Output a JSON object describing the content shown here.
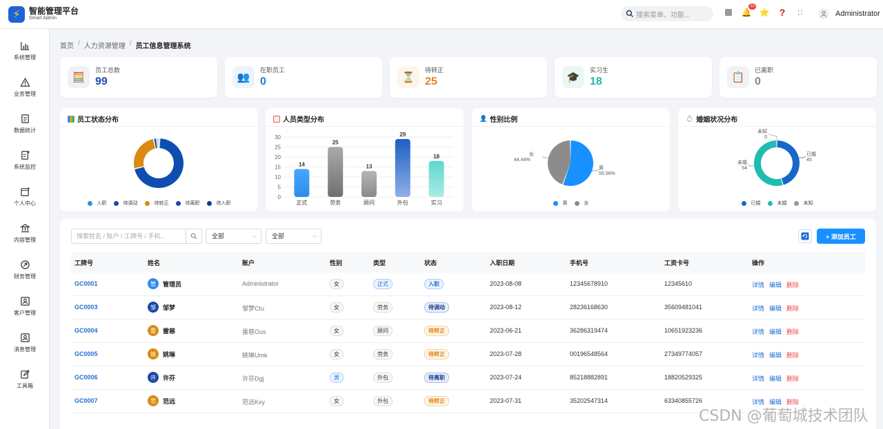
{
  "app": {
    "title": "智能管理平台",
    "subtitle": "Smart Admin"
  },
  "topbar": {
    "search_placeholder": "搜索菜单、功能...",
    "notification_count": "12",
    "username": "Administrator"
  },
  "sidebar": {
    "items": [
      {
        "label": "系统管理",
        "icon": "bar-chart-icon"
      },
      {
        "label": "业务管理",
        "icon": "warning-triangle-icon"
      },
      {
        "label": "数据统计",
        "icon": "document-icon"
      },
      {
        "label": "系统监控",
        "icon": "document-plus-icon"
      },
      {
        "label": "个人中心",
        "icon": "calendar-plus-icon"
      },
      {
        "label": "内容管理",
        "icon": "bank-icon"
      },
      {
        "label": "财务管理",
        "icon": "arrow-circle-icon"
      },
      {
        "label": "客户管理",
        "icon": "person-card-icon"
      },
      {
        "label": "消息管理",
        "icon": "person-card-icon"
      },
      {
        "label": "工具箱",
        "icon": "edit-box-icon"
      }
    ]
  },
  "breadcrumb": [
    "首页",
    "人力资源管理",
    "员工信息管理系统"
  ],
  "stats": [
    {
      "label": "员工总数",
      "value": "99",
      "color": "#1b4fa8",
      "bg": "#eef2f8",
      "icon": "🧮"
    },
    {
      "label": "在职员工",
      "value": "0",
      "color": "#1f7de0",
      "bg": "#edf3fa",
      "icon": "👥"
    },
    {
      "label": "待转正",
      "value": "25",
      "color": "#e0861a",
      "bg": "#fdf4ea",
      "icon": "⏳"
    },
    {
      "label": "实习生",
      "value": "18",
      "color": "#23b8a8",
      "bg": "#e9f7f5",
      "icon": "🎓"
    },
    {
      "label": "已离职",
      "value": "0",
      "color": "#888888",
      "bg": "#f1f2f4",
      "icon": "📋"
    }
  ],
  "charts": {
    "status": {
      "title": "员工状态分布",
      "legend": [
        "入职",
        "待调动",
        "待转正",
        "待离职",
        "待入职"
      ]
    },
    "type": {
      "title": "人员类型分布"
    },
    "gender": {
      "title": "性别比例",
      "legend": [
        "男",
        "女"
      ]
    },
    "marital": {
      "title": "婚姻状况分布",
      "legend": [
        "已婚",
        "未婚",
        "未知"
      ]
    }
  },
  "chart_data": [
    {
      "type": "pie",
      "title": "员工状态分布",
      "categories": [
        "入职",
        "待调动",
        "待转正",
        "待离职",
        "待入职"
      ],
      "values": [
        1,
        70,
        25,
        2,
        1
      ],
      "colors": [
        "#2f8de8",
        "#0f4db0",
        "#d98a10",
        "#1a4aa8",
        "#0d3c99"
      ]
    },
    {
      "type": "bar",
      "title": "人员类型分布",
      "categories": [
        "正式",
        "劳务",
        "顾问",
        "外包",
        "实习"
      ],
      "values": [
        14,
        25,
        13,
        29,
        18
      ],
      "ylim": [
        0,
        30
      ],
      "yticks": [
        0,
        5,
        10,
        15,
        20,
        25,
        30
      ]
    },
    {
      "type": "pie",
      "title": "性别比例",
      "categories": [
        "男",
        "女"
      ],
      "values": [
        55.56,
        44.44
      ],
      "labels": [
        "男\n55.56%",
        "女\n44.44%"
      ],
      "colors": [
        "#1890ff",
        "#8c8c8c"
      ]
    },
    {
      "type": "pie",
      "title": "婚姻状况分布",
      "categories": [
        "已婚",
        "未婚",
        "未知"
      ],
      "values": [
        45,
        54,
        0
      ],
      "colors": [
        "#1767c9",
        "#1fbcb0",
        "#999999"
      ]
    }
  ],
  "filters": {
    "search_placeholder": "搜索姓名 / 账户 / 工牌号 / 手机...",
    "type_select": "全部",
    "status_select": "全部",
    "add_label": "+ 添加员工"
  },
  "table": {
    "headers": [
      "工牌号",
      "姓名",
      "账户",
      "性别",
      "类型",
      "状态",
      "入职日期",
      "手机号",
      "工资卡号",
      "操作"
    ],
    "actions": {
      "detail": "详情",
      "edit": "编辑",
      "delete": "删除"
    },
    "rows": [
      {
        "id": "GC0001",
        "avatar": "管",
        "avatar_color": "#2f8de8",
        "name": "管理员",
        "account": "Administrator",
        "gender": "女",
        "type": "正式",
        "status": "入职",
        "status_style": "st-blue",
        "date": "2023-08-08",
        "phone": "12345678910",
        "card": "12345610"
      },
      {
        "id": "GC0003",
        "avatar": "邹",
        "avatar_color": "#1a4aa8",
        "name": "邹梦",
        "account": "邹梦Ctu",
        "gender": "女",
        "type": "劳务",
        "status": "待调动",
        "status_style": "st-navy",
        "date": "2023-08-12",
        "phone": "28236168630",
        "card": "35609481041"
      },
      {
        "id": "GC0004",
        "avatar": "雷",
        "avatar_color": "#d98a10",
        "name": "雷慈",
        "account": "雷慈Ous",
        "gender": "女",
        "type": "顾问",
        "status": "待转正",
        "status_style": "st-orange",
        "date": "2023-06-21",
        "phone": "36286319474",
        "card": "10651923236"
      },
      {
        "id": "GC0005",
        "avatar": "姚",
        "avatar_color": "#d98a10",
        "name": "姚琳",
        "account": "姚琳Umk",
        "gender": "女",
        "type": "劳务",
        "status": "待转正",
        "status_style": "st-orange",
        "date": "2023-07-28",
        "phone": "00196548564",
        "card": "27349774057"
      },
      {
        "id": "GC0006",
        "avatar": "许",
        "avatar_color": "#1a4aa8",
        "name": "许芬",
        "account": "许芬Dgj",
        "gender": "男",
        "gender_blue": true,
        "type": "外包",
        "status": "待离职",
        "status_style": "st-navy",
        "date": "2023-07-24",
        "phone": "85218882891",
        "card": "18820529325"
      },
      {
        "id": "GC0007",
        "avatar": "范",
        "avatar_color": "#d98a10",
        "name": "范远",
        "account": "范远Kxy",
        "gender": "女",
        "type": "外包",
        "status": "待转正",
        "status_style": "st-orange",
        "date": "2023-07-31",
        "phone": "35202547314",
        "card": "63340855726"
      }
    ]
  },
  "watermark": "CSDN @葡萄城技术团队"
}
